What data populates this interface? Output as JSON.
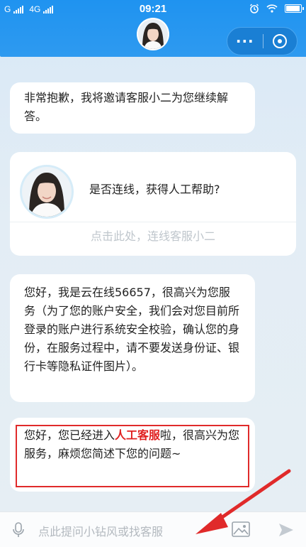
{
  "status_bar": {
    "carrier_left": "G",
    "network": "4G",
    "time": "09:21",
    "battery_level": 0.85
  },
  "header": {
    "avatar_icon": "agent-avatar",
    "menu_label": "···",
    "close_icon": "close-circle-icon"
  },
  "messages": [
    {
      "text": "非常抱歉，我将邀请客服小二为您继续解答。"
    },
    {
      "text": "您好，我是云在线56657，很高兴为您服务（为了您的账户安全，我们会对您目前所登录的账户进行系统安全校验，确认您的身份，在服务过程中，请不要发送身份证、银行卡等隐私证件图片）。"
    }
  ],
  "card": {
    "question": "是否连线，获得人工帮助?",
    "link": "点击此处，连线客服小二"
  },
  "last_message": {
    "prefix": "您好，您已经进入",
    "highlight": "人工客服",
    "suffix": "啦，很高兴为您服务，麻烦您简述下您的问题~"
  },
  "input": {
    "placeholder": "点此提问小钻风或找客服"
  },
  "colors": {
    "header": "#1f93f0",
    "highlight": "#e02020",
    "annotation": "#e02a2a"
  }
}
